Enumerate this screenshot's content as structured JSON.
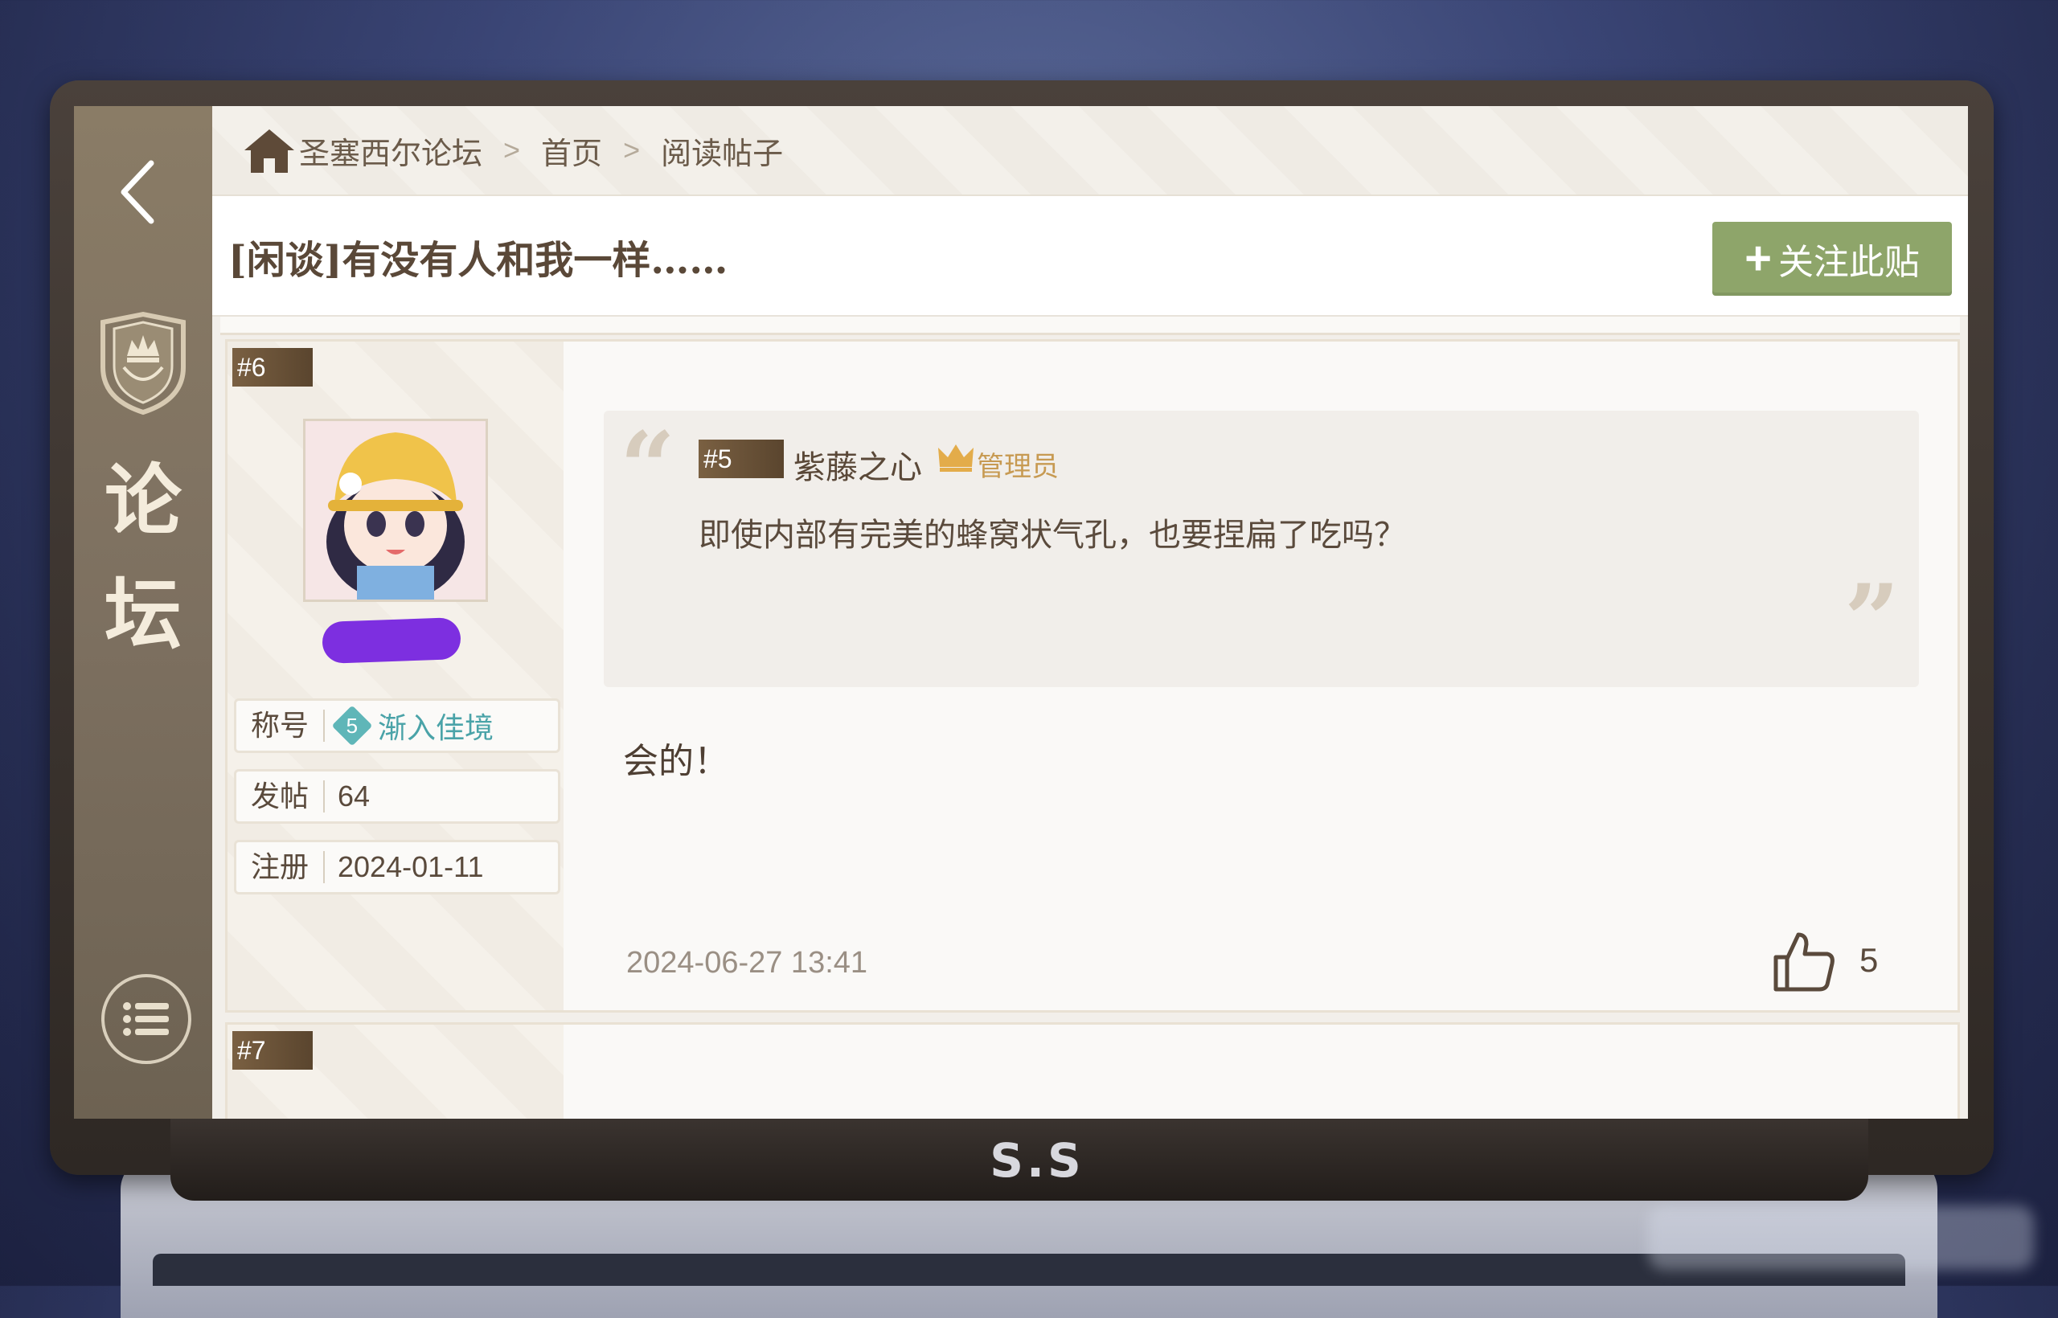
{
  "breadcrumb": {
    "items": [
      "圣塞西尔论坛",
      "首页",
      "阅读帖子"
    ],
    "separator": ">"
  },
  "sidebar": {
    "title_chars": [
      "论",
      "坛"
    ]
  },
  "post_header": {
    "title": "[闲谈]有没有人和我一样……",
    "follow_label": "关注此贴",
    "follow_icon": "+"
  },
  "posts": [
    {
      "floor": "#6",
      "user": {
        "title_label": "称号",
        "title_level": "5",
        "title_value": "渐入佳境",
        "posts_label": "发帖",
        "posts_value": "64",
        "register_label": "注册",
        "register_value": "2024-01-11"
      },
      "quote": {
        "floor": "#5",
        "user": "紫藤之心",
        "role": "管理员",
        "text": "即使内部有完美的蜂窝状气孔，也要捏扁了吃吗？"
      },
      "content": "会的！",
      "date": "2024-06-27  13:41",
      "likes": "5"
    },
    {
      "floor": "#7"
    }
  ],
  "device": {
    "brand": "S.S"
  },
  "colors": {
    "accent_green": "#8ea56a",
    "floor_tag": "#6a5038",
    "admin_gold": "#c79a52",
    "title_teal": "#4aa3a8"
  }
}
